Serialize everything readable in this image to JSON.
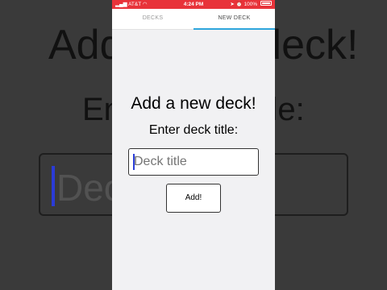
{
  "status_bar": {
    "carrier": "AT&T",
    "time": "4:24 PM",
    "battery": "100%"
  },
  "tabs": [
    {
      "label": "DECKS",
      "active": false
    },
    {
      "label": "NEW DECK",
      "active": true
    }
  ],
  "form": {
    "heading": "Add a new deck!",
    "subheading": "Enter deck title:",
    "input_placeholder": "Deck title",
    "input_value": "",
    "submit_label": "Add!"
  },
  "colors": {
    "status_bar": "#e8333a",
    "tab_indicator": "#2da5dc",
    "background": "#f1f1f3"
  }
}
